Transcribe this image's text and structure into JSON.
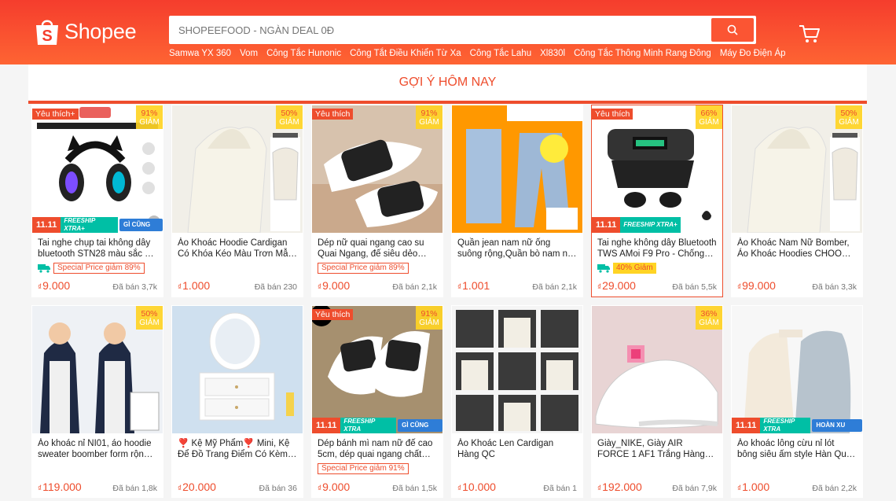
{
  "header": {
    "logo_text": "Shopee",
    "search_placeholder": "SHOPEEFOOD - NGÀN DEAL 0Đ",
    "search_icon": "search-icon",
    "cart_icon": "cart-icon",
    "suggestions": [
      "Samwa YX 360",
      "Vom",
      "Công Tắc Hunonic",
      "Công Tắt Điều Khiển Từ Xa",
      "Công Tắc Lahu",
      "Xl830l",
      "Công Tắc Thông Minh Rang Đông",
      "Máy Đo Điện Áp"
    ]
  },
  "section_title": "Gợi ý hôm nay",
  "colors": {
    "brand": "#ee4d2d",
    "discount_badge": "#ffd424",
    "freeship": "#00bfa5"
  },
  "currency": "₫",
  "products": [
    {
      "name": "Tai nghe chụp tai không dây bluetooth STN28 màu sắc dễ thương hình tai mèo",
      "price": "9.000",
      "sold": "Đã bán 3,7k",
      "fav": "Yêu thích+",
      "discount_pct": "91%",
      "discount_word": "GIẢM",
      "strip": [
        "11.11",
        "FREESHIP XTRA+",
        "GÌ CŨNG RẺ"
      ],
      "tag": "Special Price giảm 89%",
      "tag_type": "special",
      "truck": true
    },
    {
      "name": "Áo Khoác Hoodie Cardigan Có Khóa Kéo Màu Trơn Mẫu Mới Phong Cách",
      "price": "1.000",
      "sold": "Đã bán 230",
      "fav": "",
      "discount_pct": "50%",
      "discount_word": "GIẢM",
      "strip": [],
      "tag": "",
      "tag_type": "",
      "truck": false
    },
    {
      "name": "Dép nữ quai ngang cao su Quai Ngang, đế siêu dẻo chống trơn trượt",
      "price": "9.000",
      "sold": "Đã bán 2,1k",
      "fav": "Yêu thích",
      "discount_pct": "91%",
      "discount_word": "GIẢM",
      "strip": [],
      "tag": "Special Price giảm 89%",
      "tag_type": "special",
      "truck": false
    },
    {
      "name": "Quần jean nam nữ ống suông rộng,Quần bò nam nữ dáng suông",
      "price": "1.001",
      "sold": "Đã bán 2,1k",
      "fav": "",
      "discount_pct": "",
      "discount_word": "",
      "strip": [],
      "tag": "",
      "tag_type": "",
      "truck": false
    },
    {
      "name": "Tai nghe không dây Bluetooth TWS AMoi F9 Pro - Chống nước",
      "price": "29.000",
      "sold": "Đã bán 5,5k",
      "fav": "Yêu thích",
      "discount_pct": "66%",
      "discount_word": "GIẢM",
      "strip": [
        "11.11",
        "FREESHIP XTRA+"
      ],
      "tag": "40% Giảm",
      "tag_type": "pct",
      "truck": true
    },
    {
      "name": "Áo Khoác Nam Nữ Bomber, Áo Khoác Hoodies CHOOSE Chất Nỉ",
      "price": "99.000",
      "sold": "Đã bán 3,3k",
      "fav": "",
      "discount_pct": "50%",
      "discount_word": "GIẢM",
      "strip": [],
      "tag": "",
      "tag_type": "",
      "truck": false
    },
    {
      "name": "Áo khoác nỉ NI01, áo hoodie sweater boomber form rộng unisex",
      "price": "119.000",
      "sold": "Đã bán 1,8k",
      "fav": "",
      "discount_pct": "50%",
      "discount_word": "GIẢM",
      "strip": [],
      "tag": "",
      "tag_type": "",
      "truck": false
    },
    {
      "name": "❣️ Kệ Mỹ Phẩm❣️ Mini, Kệ Để Đồ Trang Điểm Có Kèm Gương",
      "price": "20.000",
      "sold": "Đã bán 36",
      "fav": "",
      "discount_pct": "",
      "discount_word": "",
      "strip": [],
      "tag": "",
      "tag_type": "",
      "truck": false
    },
    {
      "name": "Dép bánh mì nam nữ đế cao 5cm, dép quai ngang chất liệu EVA",
      "price": "9.000",
      "sold": "Đã bán 1,5k",
      "fav": "Yêu thích",
      "discount_pct": "91%",
      "discount_word": "GIẢM",
      "strip": [
        "11.11",
        "FREESHIP XTRA",
        "GÌ CŨNG RẺ"
      ],
      "tag": "Special Price giảm 91%",
      "tag_type": "special",
      "truck": false
    },
    {
      "name": "Áo Khoác Len Cardigan Hàng QC",
      "price": "10.000",
      "sold": "Đã bán 1",
      "fav": "",
      "discount_pct": "",
      "discount_word": "",
      "strip": [],
      "tag": "",
      "tag_type": "",
      "truck": false
    },
    {
      "name": "Giày_NIKE, Giày AIR FORCE 1 AF1 Trắng Hàng Cao Cấp Full Box",
      "price": "192.000",
      "sold": "Đã bán 7,9k",
      "fav": "",
      "discount_pct": "36%",
      "discount_word": "GIẢM",
      "strip": [],
      "tag": "",
      "tag_type": "",
      "truck": false
    },
    {
      "name": "Áo khoác lông cừu nỉ lót bông siêu ấm style Hàn Quốc MINION",
      "price": "1.000",
      "sold": "Đã bán 2,2k",
      "fav": "",
      "discount_pct": "",
      "discount_word": "",
      "strip": [
        "11.11",
        "FREESHIP XTRA",
        "HOÀN XU XTRA"
      ],
      "tag": "",
      "tag_type": "",
      "truck": false
    }
  ]
}
